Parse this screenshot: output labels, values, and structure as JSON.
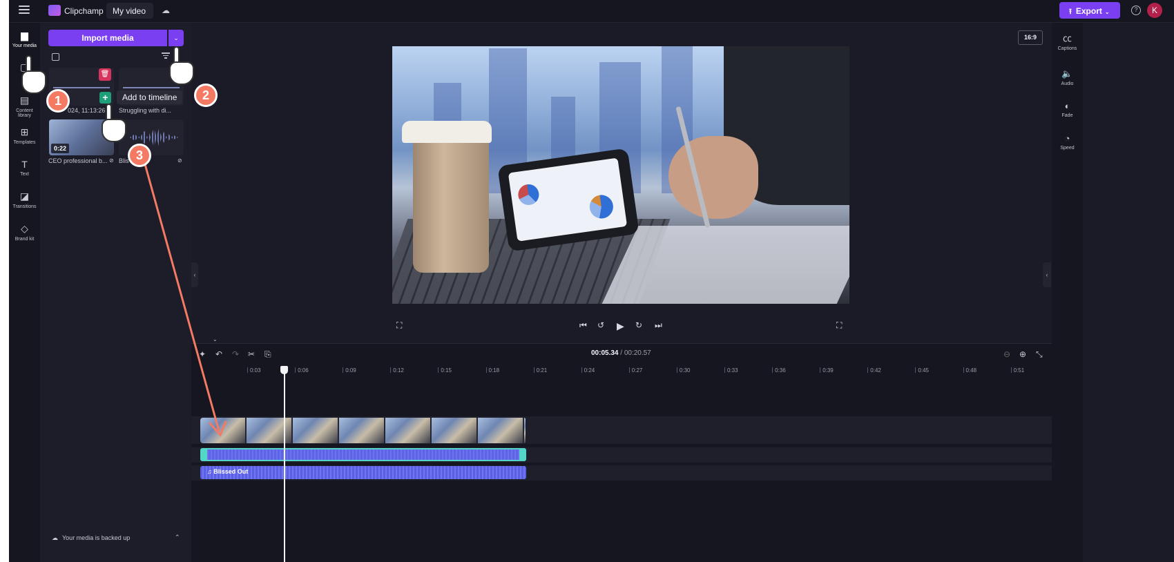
{
  "app": {
    "brand": "Clipchamp",
    "project_title": "My video",
    "export_label": "Export",
    "avatar_initial": "K",
    "help_symbol": "?"
  },
  "left_rail": [
    {
      "label": "Your media",
      "icon": "folder-icon"
    },
    {
      "label": "Re",
      "icon": "record-icon"
    },
    {
      "label": "Content library",
      "icon": "library-icon"
    },
    {
      "label": "Templates",
      "icon": "templates-icon"
    },
    {
      "label": "Text",
      "icon": "text-icon"
    },
    {
      "label": "Transitions",
      "icon": "transitions-icon"
    },
    {
      "label": "Brand kit",
      "icon": "brand-kit-icon"
    }
  ],
  "media": {
    "import_label": "Import media",
    "tooltip": "Add to timeline",
    "items": [
      {
        "label": "024, 11:13:26..."
      },
      {
        "label": "Struggling with di..."
      },
      {
        "label": "CEO professional b...",
        "duration": "0:22"
      },
      {
        "label": "Blis"
      }
    ],
    "backup_text": "Your media is backed up"
  },
  "preview": {
    "aspect_ratio": "16:9"
  },
  "timeline": {
    "current_time": "00:05.34",
    "total_time": "/ 00:20.57",
    "ticks": [
      "0:03",
      "0:06",
      "0:09",
      "0:12",
      "0:15",
      "0:18",
      "0:21",
      "0:24",
      "0:27",
      "0:30",
      "0:33",
      "0:36",
      "0:39",
      "0:42",
      "0:45",
      "0:48",
      "0:51"
    ],
    "audio_track_label": "Blissed Out"
  },
  "right_rail": [
    {
      "label": "Captions",
      "icon": "captions-icon"
    },
    {
      "label": "Audio",
      "icon": "audio-icon"
    },
    {
      "label": "Fade",
      "icon": "fade-icon"
    },
    {
      "label": "Speed",
      "icon": "speed-icon"
    }
  ],
  "annotations": {
    "step1": "1",
    "step2": "2",
    "step3": "3"
  },
  "colors": {
    "accent": "#7b3ff2",
    "annotation": "#f47a63",
    "audio_clip": "#5d64e6",
    "selection": "#53d6c8"
  }
}
